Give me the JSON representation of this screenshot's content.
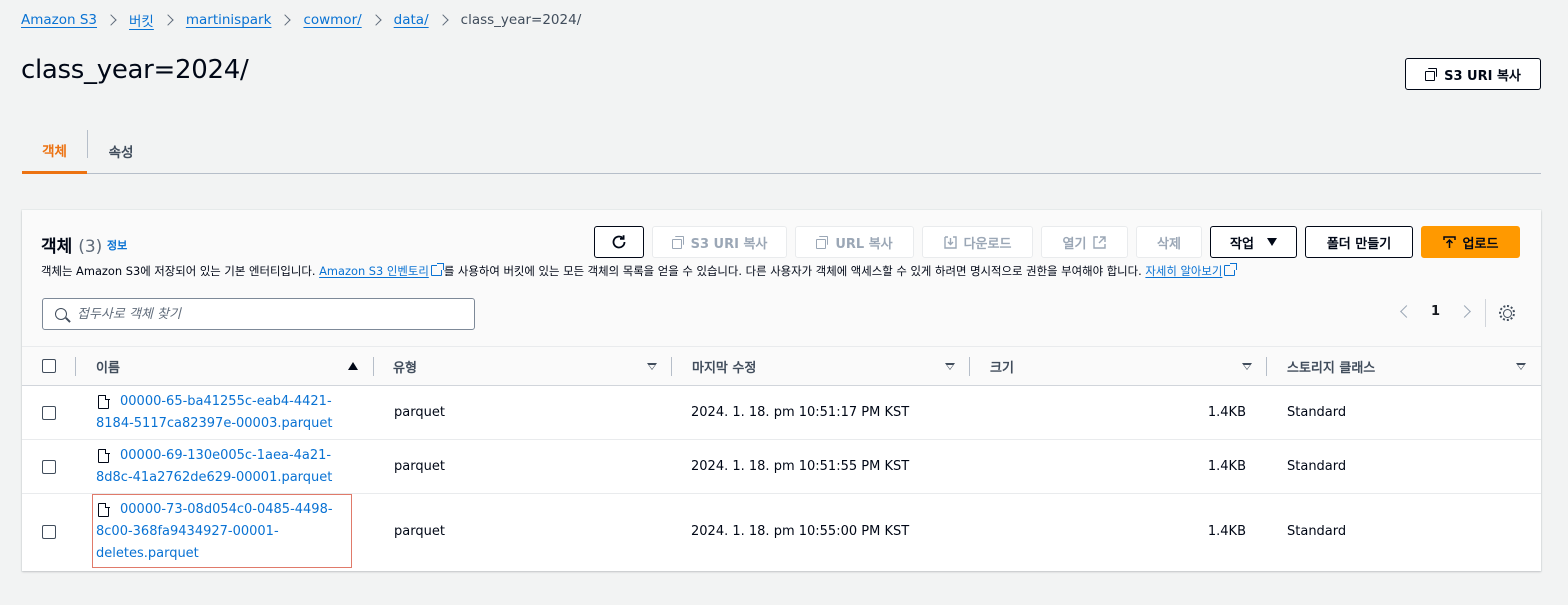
{
  "breadcrumb": {
    "items": [
      "Amazon S3",
      "버킷",
      "martinispark",
      "cowmor/",
      "data/"
    ],
    "current": "class_year=2024/"
  },
  "page": {
    "title": "class_year=2024/",
    "copy_uri_button": "S3 URI 복사"
  },
  "tabs": [
    {
      "label": "객체",
      "active": true
    },
    {
      "label": "속성",
      "active": false
    }
  ],
  "objects_panel": {
    "title": "객체",
    "count": "(3)",
    "info_link": "정보",
    "description": {
      "part1": "객체는 Amazon S3에 저장되어 있는 기본 엔터티입니다.",
      "link1": "Amazon S3 인벤토리",
      "part2": "를 사용하여 버킷에 있는 모든 객체의 목록을 얻을 수 있습니다. 다른 사용자가 객체에 액세스할 수 있게 하려면 명시적으로 권한을 부여해야 합니다.",
      "link2": "자세히 알아보기"
    },
    "toolbar": {
      "copy_s3_uri": "S3 URI 복사",
      "copy_url": "URL 복사",
      "download": "다운로드",
      "open": "열기",
      "delete": "삭제",
      "actions": "작업",
      "create_folder": "폴더 만들기",
      "upload": "업로드"
    },
    "search": {
      "placeholder": "접두사로 객체 찾기"
    },
    "pagination": {
      "current_page": "1"
    },
    "columns": [
      "이름",
      "유형",
      "마지막 수정",
      "크기",
      "스토리지 클래스"
    ],
    "rows": [
      {
        "name_line1": "00000-65-ba41255c-eab4-4421-",
        "name_line2": "8184-5117ca82397e-00003.parquet",
        "name_line3": "",
        "type": "parquet",
        "last_modified": "2024. 1. 18. pm 10:51:17 PM KST",
        "size": "1.4KB",
        "storage_class": "Standard"
      },
      {
        "name_line1": "00000-69-130e005c-1aea-4a21-",
        "name_line2": "8d8c-41a2762de629-00001.parquet",
        "name_line3": "",
        "type": "parquet",
        "last_modified": "2024. 1. 18. pm 10:51:55 PM KST",
        "size": "1.4KB",
        "storage_class": "Standard"
      },
      {
        "name_line1": "00000-73-08d054c0-0485-4498-",
        "name_line2": "8c00-368fa9434927-00001-",
        "name_line3": "deletes.parquet",
        "type": "parquet",
        "last_modified": "2024. 1. 18. pm 10:55:00 PM KST",
        "size": "1.4KB",
        "storage_class": "Standard"
      }
    ]
  },
  "colors": {
    "link": "#0972d3",
    "active_tab": "#ec7211",
    "primary_button": "#ff9900",
    "highlight_border": "#e07a6a"
  }
}
